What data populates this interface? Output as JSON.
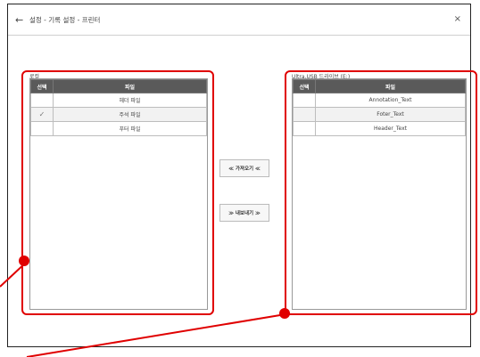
{
  "window": {
    "title": "설정 - 기록 설정 - 프린터",
    "back_icon": "←",
    "close_icon": "×"
  },
  "left_panel": {
    "label": "로컬",
    "columns": [
      "선택",
      "파일"
    ],
    "rows": [
      {
        "checked": false,
        "name": "헤더 파일"
      },
      {
        "checked": true,
        "name": "주석 파일"
      },
      {
        "checked": false,
        "name": "푸터 파일"
      }
    ]
  },
  "right_panel": {
    "label": "Ultra.USB 드라이브 (E:)",
    "columns": [
      "선택",
      "파일"
    ],
    "rows": [
      {
        "checked": false,
        "name": "Annotation_Text"
      },
      {
        "checked": false,
        "name": "Foter_Text"
      },
      {
        "checked": false,
        "name": "Header_Text"
      }
    ]
  },
  "actions": {
    "import_label": "≪ 가져오기 ≪",
    "export_label": "≫ 내보내기 ≫"
  },
  "check_glyph": "✓",
  "colors": {
    "highlight": "#e00000",
    "header_bg": "#5a5a5a"
  }
}
